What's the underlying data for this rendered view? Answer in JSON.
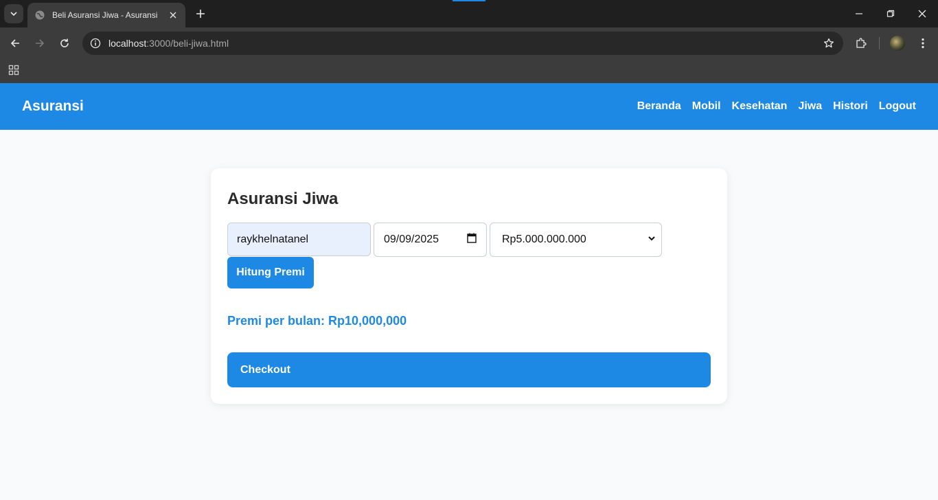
{
  "browser": {
    "tab_title": "Beli Asuransi Jiwa - Asuransi",
    "url_host": "localhost",
    "url_path": ":3000/beli-jiwa.html"
  },
  "navbar": {
    "brand": "Asuransi",
    "links": [
      "Beranda",
      "Mobil",
      "Kesehatan",
      "Jiwa",
      "Histori",
      "Logout"
    ]
  },
  "form": {
    "title": "Asuransi Jiwa",
    "name_value": "raykhelnatanel",
    "date_value": "09/09/2025",
    "coverage_value": "Rp5.000.000.000",
    "calc_button": "Hitung Premi",
    "premium_text": "Premi per bulan: Rp10,000,000",
    "checkout_button": "Checkout"
  },
  "colors": {
    "primary": "#1e88e5",
    "page_bg": "#f8fafc",
    "name_field_bg": "#e8f0fe"
  }
}
